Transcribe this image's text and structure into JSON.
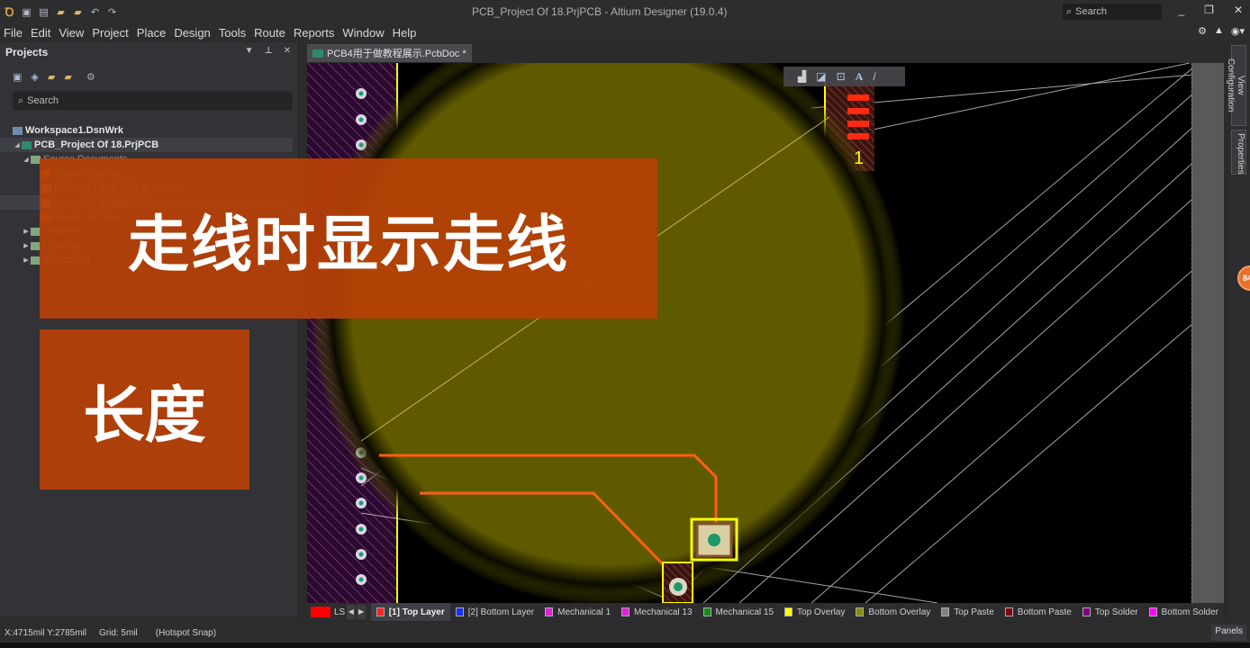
{
  "titlebar": {
    "title": "PCB_Project Of 18.PrjPCB - Altium Designer (19.0.4)",
    "search_placeholder": "Search",
    "quick_access_icons": [
      "app-logo-icon",
      "save-icon",
      "save-all-icon",
      "open-icon",
      "open-project-icon",
      "undo-icon",
      "redo-icon"
    ]
  },
  "menubar": {
    "items": [
      "File",
      "Edit",
      "View",
      "Project",
      "Place",
      "Design",
      "Tools",
      "Route",
      "Reports",
      "Window",
      "Help"
    ],
    "right_icons": [
      "gear-icon",
      "bell-icon",
      "user-icon"
    ]
  },
  "projects_panel": {
    "title": "Projects",
    "search_placeholder": "Search",
    "toolbar_icons": [
      "save-icon",
      "compile-icon",
      "open-folder-icon",
      "folder-settings-icon",
      "gear-icon"
    ],
    "tree": [
      {
        "label": "Workspace1.DsnWrk",
        "level": 0,
        "bold": true
      },
      {
        "label": "PCB_Project Of 18.PrjPCB",
        "level": 1,
        "bold": true,
        "selected": true,
        "expanded": true
      },
      {
        "label": "Source Documents",
        "level": 2,
        "folder": true,
        "expanded": true
      },
      {
        "label": "Sheet1.SchDoc",
        "level": 3
      },
      {
        "label": "PCB3用于做教程展示.PcbDoc",
        "level": 3
      },
      {
        "label": "PCB4用于做教程展示.PcbDoc *",
        "level": 3,
        "selected": true
      },
      {
        "label": "Sheet2.SchDoc",
        "level": 3
      },
      {
        "label": "Settings",
        "level": 2,
        "folder": true
      },
      {
        "label": "Libraries",
        "level": 2,
        "folder": true
      },
      {
        "label": "Generated",
        "level": 2,
        "folder": true
      }
    ]
  },
  "document_tab": {
    "label": "PCB4用于做教程展示.PcbDoc *"
  },
  "pcb_toolbar_icons": [
    "filter-icon",
    "bar-chart-icon",
    "rectangle-icon",
    "dimension-icon",
    "text-icon",
    "line-icon"
  ],
  "designator": "1",
  "overlays": {
    "line1": "走线时显示走线",
    "line2": "长度"
  },
  "side_tabs": [
    "View Configuration",
    "Properties"
  ],
  "notification_badge": "84",
  "layer_bar": {
    "ls_label": "LS",
    "ls_color": "#ff0000",
    "layers": [
      {
        "label": "[1] Top Layer",
        "color": "#ff2020",
        "active": true
      },
      {
        "label": "[2] Bottom Layer",
        "color": "#1530ff"
      },
      {
        "label": "Mechanical 1",
        "color": "#e020e0"
      },
      {
        "label": "Mechanical 13",
        "color": "#e020e0"
      },
      {
        "label": "Mechanical 15",
        "color": "#1a8a1a"
      },
      {
        "label": "Top Overlay",
        "color": "#ffff00"
      },
      {
        "label": "Bottom Overlay",
        "color": "#8a8a10"
      },
      {
        "label": "Top Paste",
        "color": "#808080"
      },
      {
        "label": "Bottom Paste",
        "color": "#800010"
      },
      {
        "label": "Top Solder",
        "color": "#800080"
      },
      {
        "label": "Bottom Solder",
        "color": "#ff00ff"
      }
    ]
  },
  "statusbar": {
    "coords": "X:4715mil Y:2785mil",
    "grid": "Grid: 5mil",
    "snap": "(Hotspot Snap)",
    "panels_label": "Panels"
  }
}
